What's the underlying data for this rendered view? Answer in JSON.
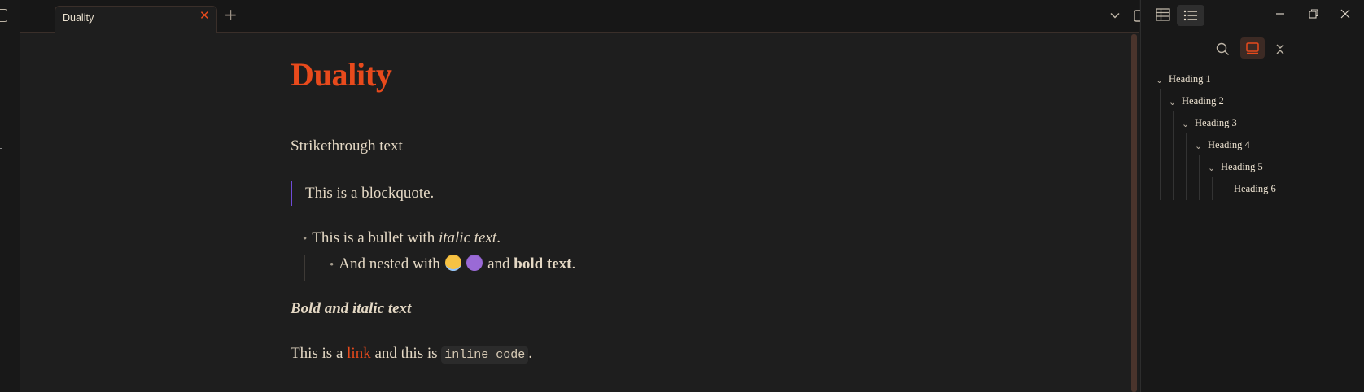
{
  "tab": {
    "title": "Duality",
    "close": "✕",
    "new_tab": "+"
  },
  "document": {
    "title": "Duality",
    "strikethrough": "Strikethrough text",
    "blockquote": "This is a blockquote.",
    "bullet1": {
      "prefix": "This is a bullet with ",
      "italic": "italic text",
      "suffix": "."
    },
    "bullet2": {
      "prefix": "And nested with",
      "middle": "and",
      "bold": "bold text",
      "suffix": "."
    },
    "bullet_marker": "•",
    "bold_italic": "Bold and italic text",
    "link_para": {
      "prefix": "This is a ",
      "link": "link",
      "middle": " and this is ",
      "code": "inline code",
      "suffix": "."
    }
  },
  "outline": {
    "items": [
      {
        "label": "Heading 1",
        "chevron": "⌄"
      },
      {
        "label": "Heading 2",
        "chevron": "⌄"
      },
      {
        "label": "Heading 3",
        "chevron": "⌄"
      },
      {
        "label": "Heading 4",
        "chevron": "⌄"
      },
      {
        "label": "Heading 5",
        "chevron": "⌄"
      },
      {
        "label": "Heading 6"
      }
    ]
  },
  "colors": {
    "accent": "#e84a1c",
    "blockquote_bar": "#6f4bd8",
    "text": "#e4d8c4",
    "bg": "#1e1e1e"
  },
  "icons": [
    "sidebar-toggle-icon",
    "close-icon",
    "plus-icon",
    "chevron-down-icon",
    "right-sidebar-icon",
    "table-icon",
    "list-icon",
    "minimize-icon",
    "restore-icon",
    "close-window-icon",
    "search-icon",
    "view-icon",
    "collapse-icon"
  ]
}
